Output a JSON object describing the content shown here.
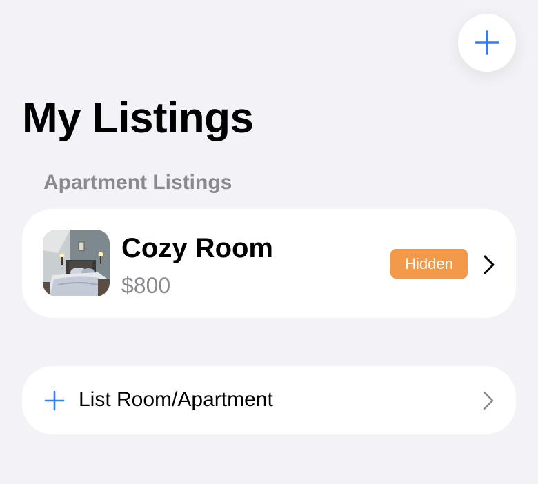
{
  "header": {
    "title": "My Listings",
    "add_button_icon": "plus-icon"
  },
  "section": {
    "title": "Apartment Listings"
  },
  "listings": [
    {
      "title": "Cozy Room",
      "price": "$800",
      "status": "Hidden",
      "status_color": "#f2994a",
      "thumbnail_icon": "bedroom-photo"
    }
  ],
  "actions": {
    "list_room_label": "List Room/Apartment",
    "list_room_icon": "plus-icon"
  },
  "colors": {
    "accent": "#2f7cf6",
    "background": "#f2f2f7",
    "card": "#ffffff",
    "secondary_text": "#8a8a8e"
  }
}
